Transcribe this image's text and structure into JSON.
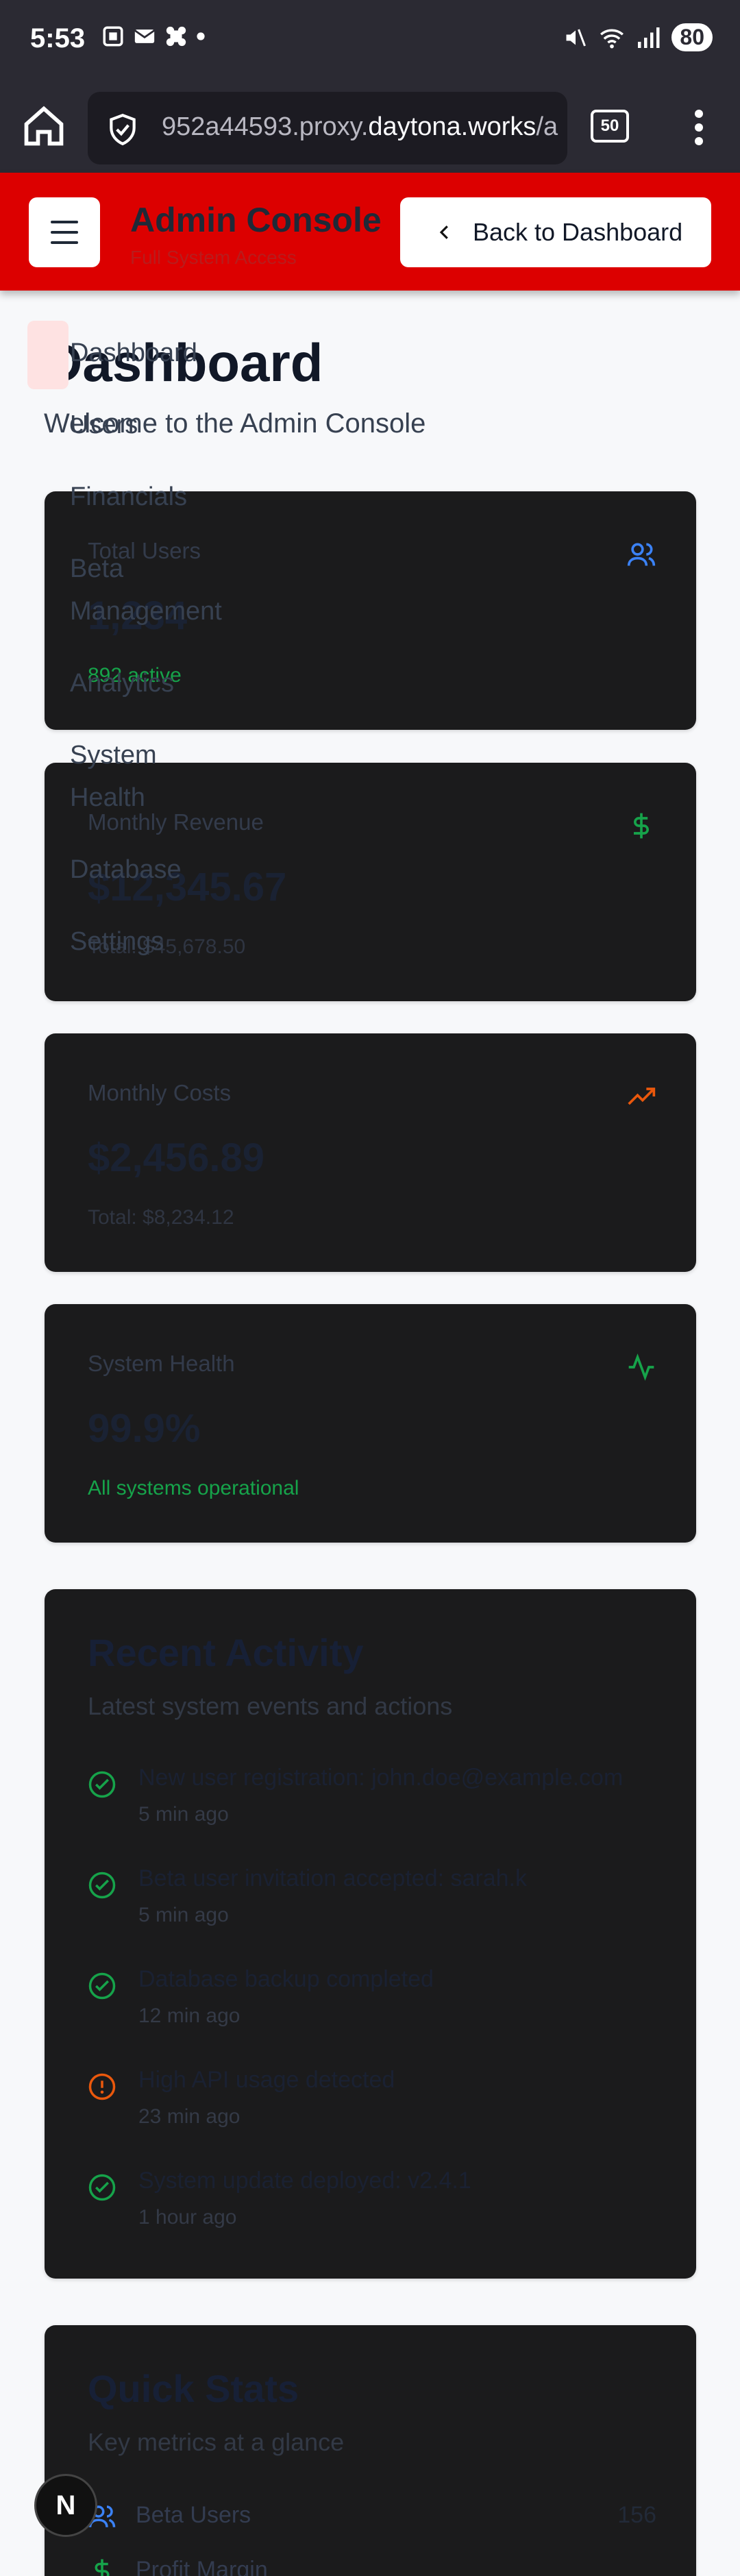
{
  "status_bar": {
    "time": "5:53",
    "battery": "80"
  },
  "browser": {
    "url_prefix": "952a44593.proxy.",
    "url_domain": "daytona.works",
    "url_suffix": "/a",
    "tab_count": "50"
  },
  "header": {
    "title": "Admin Console",
    "subtitle": "Full System Access",
    "back_label": "Back to Dashboard"
  },
  "nav": {
    "items": [
      "Dashboard",
      "Users",
      "Financials",
      "Beta",
      "Management",
      "Analytics",
      "System",
      "Health",
      "Database",
      "Settings"
    ]
  },
  "page": {
    "title": "Dashboard",
    "subtitle": "Welcome to the Admin Console"
  },
  "stats": [
    {
      "label": "Total Users",
      "value": "1,234",
      "note": "892 active",
      "icon": "users-icon",
      "color": "#3b82f6"
    },
    {
      "label": "Monthly Revenue",
      "value": "$12,345.67",
      "note": "Total: $45,678.50",
      "icon": "dollar-icon",
      "color": "#16a34a"
    },
    {
      "label": "Monthly Costs",
      "value": "$2,456.89",
      "note": "Total: $8,234.12",
      "icon": "trending-up-icon",
      "color": "#ea580c"
    },
    {
      "label": "System Health",
      "value": "99.9%",
      "note": "All systems operational",
      "icon": "activity-icon",
      "color": "#16a34a"
    }
  ],
  "recent_activity": {
    "title": "Recent Activity",
    "subtitle": "Latest system events and actions",
    "items": [
      {
        "text": "New user registration: john.doe@example.com",
        "time": "5 min ago",
        "status": "success"
      },
      {
        "text": "Beta user invitation accepted: sarah.k",
        "time": "5 min ago",
        "status": "success"
      },
      {
        "text": "Database backup completed",
        "time": "12 min ago",
        "status": "success"
      },
      {
        "text": "High API usage detected",
        "time": "23 min ago",
        "status": "warning"
      },
      {
        "text": "System update deployed: v2.4.1",
        "time": "1 hour ago",
        "status": "success"
      }
    ]
  },
  "quick_stats": {
    "title": "Quick Stats",
    "subtitle": "Key metrics at a glance",
    "items": [
      {
        "label": "Beta Users",
        "value": "156",
        "icon": "users-icon"
      },
      {
        "label": "Profit Margin",
        "value": "",
        "icon": "dollar-icon"
      }
    ]
  },
  "badge": {
    "letter": "N"
  }
}
